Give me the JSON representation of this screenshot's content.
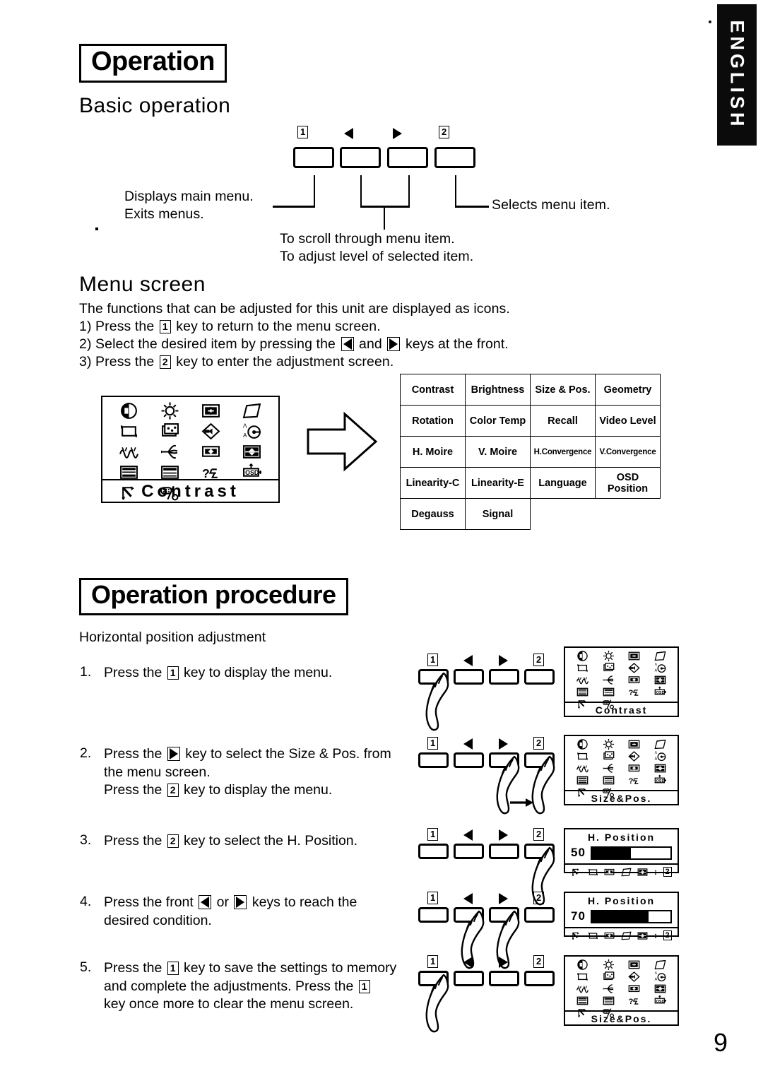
{
  "page": {
    "number": "9",
    "language_tab": "ENGLISH"
  },
  "sections": {
    "operation": {
      "heading": "Operation",
      "basic_operation": {
        "heading": "Basic operation",
        "keys": [
          {
            "name": "key-1",
            "label": "1",
            "glyph": "box-1"
          },
          {
            "name": "key-left",
            "label": "",
            "glyph": "triangle-left"
          },
          {
            "name": "key-right",
            "label": "",
            "glyph": "triangle-right"
          },
          {
            "name": "key-2",
            "label": "2",
            "glyph": "box-2"
          }
        ],
        "callouts": {
          "left_line1": "Displays main menu.",
          "left_line2": "Exits menus.",
          "right": "Selects menu item.",
          "bottom_line1": "To scroll through menu item.",
          "bottom_line2": "To adjust level of selected item."
        }
      },
      "menu_screen": {
        "heading": "Menu screen",
        "intro": "The functions that can be adjusted for this unit are displayed as icons.",
        "steps": [
          {
            "prefix": "1) Press the",
            "key": "1",
            "suffix": "key to return to the menu screen."
          },
          {
            "prefix": "2) Select the desired item by pressing the",
            "key": "◀",
            "middle": "and",
            "key2": "▶",
            "suffix": "keys at the front."
          },
          {
            "prefix": "3) Press the",
            "key": "2",
            "suffix": "key to enter the adjustment screen."
          }
        ]
      }
    },
    "procedure": {
      "heading": "Operation procedure",
      "subtitle": "Horizontal position adjustment",
      "steps": [
        {
          "number": "1.",
          "text": "Press the [1] key to display the menu.",
          "text_parts": [
            "Press the ",
            "1",
            " key to display the menu."
          ],
          "pressed_keys": [
            "key-1"
          ],
          "osd": "osd-contrast"
        },
        {
          "number": "2.",
          "text": "Press the [▶] key to select the Size & Pos. from the menu screen. Press the [2] key to display the menu.",
          "line1_a": "Press the ",
          "line1_key": "▶",
          "line1_b": " key to select the Size & Pos. from",
          "line2": "the menu screen.",
          "line3_a": "Press the ",
          "line3_key": "2",
          "line3_b": " key to display the menu.",
          "pressed_keys": [
            "key-right",
            "key-2"
          ],
          "osd": "osd-size-pos"
        },
        {
          "number": "3.",
          "text": "Press the [2] key to select the H. Position.",
          "line1_a": "Press the ",
          "line1_key": "2",
          "line1_b": " key to select the H. Position.",
          "pressed_keys": [
            "key-2"
          ],
          "osd": "osd-h-position-50"
        },
        {
          "number": "4.",
          "text": "Press the front [◀] or [▶] keys to reach the desired condition.",
          "line1_a": "Press the front ",
          "line1_key": "◀",
          "line1_mid": " or ",
          "line1_key2": "▶",
          "line1_b": " keys to reach the",
          "line2": "desired condition.",
          "pressed_keys": [
            "key-left",
            "key-right"
          ],
          "osd": "osd-h-position-70"
        },
        {
          "number": "5.",
          "text": "Press the [1] key to save the settings to memory and complete the adjustments. Press the [1] key once more to clear the menu screen.",
          "line1_a": "Press the ",
          "line1_key": "1",
          "line1_b": " key to save the settings to memory",
          "line2_a": "and complete the adjustments.  Press the ",
          "line2_key": "1",
          "line3": "key once more to clear the menu screen.",
          "pressed_keys": [
            "key-1"
          ],
          "osd": "osd-size-pos-2"
        }
      ]
    }
  },
  "osd_icons": [
    "contrast-icon",
    "brightness-icon",
    "size-position-icon",
    "geometry-icon",
    "rotation-icon",
    "color-temp-icon",
    "recall-icon",
    "video-level-icon",
    "h-moire-icon",
    "v-moire-icon",
    "h-convergence-icon",
    "v-convergence-icon",
    "linearity-c-icon",
    "linearity-e-icon",
    "language-icon",
    "osd-position-icon",
    "degauss-icon",
    "signal-icon"
  ],
  "osd_screens": {
    "contrast": {
      "title": "Contrast"
    },
    "size_pos": {
      "title": "Size&Pos."
    },
    "h_position_50": {
      "title": "H. Position",
      "value": "50",
      "percent": 50
    },
    "h_position_70": {
      "title": "H. Position",
      "value": "70",
      "percent": 72
    },
    "adjust_bar_keys": [
      "degauss-icon",
      "size-icon",
      "h-position-icon",
      "v-position-icon",
      "v-size-icon",
      "2"
    ]
  },
  "menu_map": {
    "rows": [
      [
        "Contrast",
        "Brightness",
        "Size & Pos.",
        "Geometry"
      ],
      [
        "Rotation",
        "Color Temp",
        "Recall",
        "Video Level"
      ],
      [
        "H. Moire",
        "V. Moire",
        "H.Convergence",
        "V.Convergence"
      ],
      [
        "Linearity-C",
        "Linearity-E",
        "Language",
        "OSD\nPosition"
      ],
      [
        "Degauss",
        "Signal",
        "",
        ""
      ]
    ],
    "small_cells": [
      "H.Convergence",
      "V.Convergence"
    ]
  },
  "colors": {
    "ink": "#000000",
    "paper": "#ffffff",
    "tab_background": "#0b0b0b",
    "tab_text": "#ffffff"
  }
}
